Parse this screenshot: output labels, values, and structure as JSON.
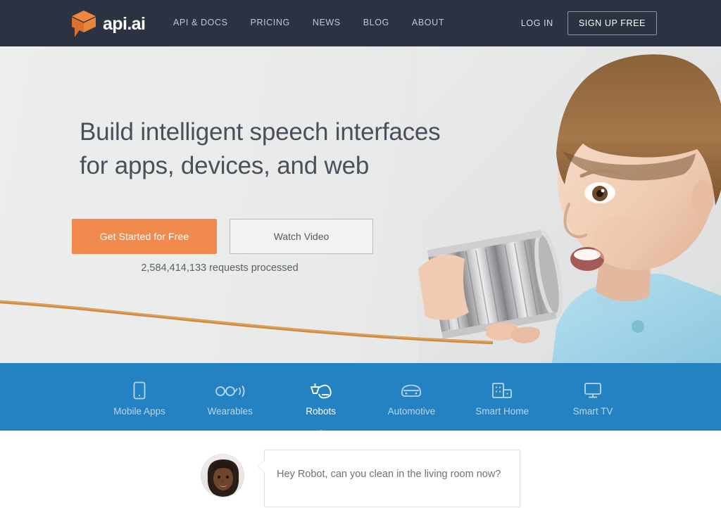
{
  "header": {
    "logo": {
      "icon": "api-ai-cube-logo-icon",
      "text": "api.ai"
    },
    "nav": [
      {
        "label": "API & DOCS"
      },
      {
        "label": "PRICING"
      },
      {
        "label": "NEWS"
      },
      {
        "label": "BLOG"
      },
      {
        "label": "ABOUT"
      }
    ],
    "login_label": "LOG IN",
    "signup_label": "SIGN UP FREE",
    "background_color": "#2b3241"
  },
  "hero": {
    "headline_line1": "Build intelligent speech interfaces",
    "headline_line2": "for apps, devices, and web",
    "primary_button": "Get Started for Free",
    "secondary_button": "Watch Video",
    "requests_processed": "2,584,414,133 requests processed",
    "primary_color": "#f18a4d",
    "photo_alt": "boy-with-tin-can-telephone",
    "rope_color": "#d08a3f"
  },
  "tabbar": {
    "background_color": "#2481c2",
    "active_tab": "Robots",
    "tabs": [
      {
        "label": "Mobile Apps",
        "icon": "mobile-phone-icon",
        "active": false
      },
      {
        "label": "Wearables",
        "icon": "smart-glasses-icon",
        "active": false
      },
      {
        "label": "Robots",
        "icon": "robot-arm-icon",
        "active": true
      },
      {
        "label": "Automotive",
        "icon": "car-icon",
        "active": false
      },
      {
        "label": "Smart Home",
        "icon": "buildings-icon",
        "active": false
      },
      {
        "label": "Smart TV",
        "icon": "monitor-icon",
        "active": false
      }
    ]
  },
  "chat": {
    "avatar_alt": "user-avatar-photo",
    "message": "Hey Robot, can you clean in the living room now?"
  }
}
